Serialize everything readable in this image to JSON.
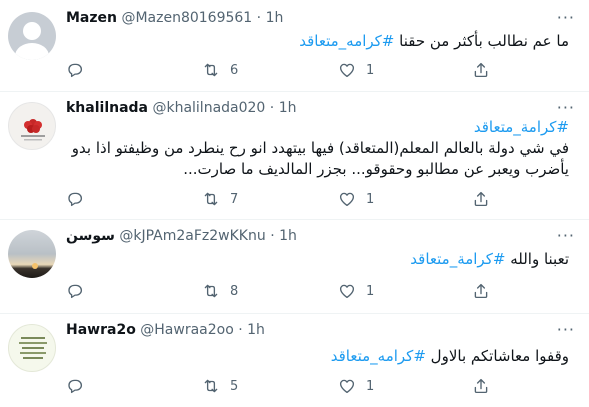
{
  "tweets": [
    {
      "name": "Mazen",
      "handle": "@Mazen80169561",
      "dot": "·",
      "time": "1h",
      "lines": [
        {
          "text": "ما عم نطالب بأكثر من حقنا ",
          "hashtag": "#كرامه_متعاقد"
        }
      ],
      "retweets": "6",
      "likes": "1"
    },
    {
      "name": "khalilnada",
      "handle": "@khalilnada020",
      "dot": "·",
      "time": "1h",
      "lines": [
        {
          "text": "",
          "hashtag": "#كرامة_متعاقد"
        },
        {
          "text": "في شي دولة بالعالم المعلم(المتعاقد) فيها بيتهدد انو رح ينطرد من وظيفتو اذا بدو",
          "hashtag": ""
        },
        {
          "text": "يأضرب ويعبر عن مطالبو وحقوقو... بجزر المالديف ما صارت...",
          "hashtag": ""
        }
      ],
      "retweets": "7",
      "likes": "1"
    },
    {
      "name": "سوسن",
      "handle": "@kJPAm2aFz2wKKnu",
      "dot": "·",
      "time": "1h",
      "lines": [
        {
          "text": "تعبنا والله ",
          "hashtag": "#كرامة_متعاقد"
        }
      ],
      "retweets": "8",
      "likes": "1"
    },
    {
      "name": "Hawra2o",
      "handle": "@Hawraa2oo",
      "dot": "·",
      "time": "1h",
      "lines": [
        {
          "text": "وقفوا معاشاتكم بالاول ",
          "hashtag": "#كرامه_متعاقد"
        }
      ],
      "retweets": "5",
      "likes": "1"
    }
  ],
  "more_label": "···"
}
